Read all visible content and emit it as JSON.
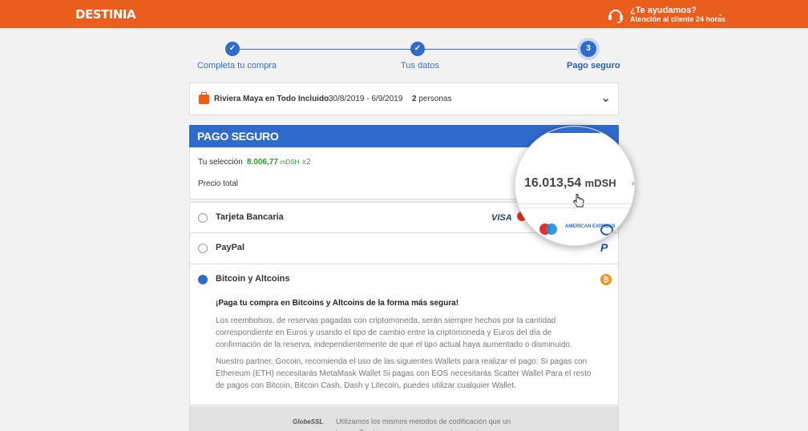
{
  "header": {
    "logo": "DESTINIA",
    "help_title": "¿Te ayudamos?",
    "help_subtitle": "Atención al cliente 24 horas",
    "brand_color": "#e95e1d"
  },
  "steps": [
    {
      "label": "Completa tu compra",
      "state": "done",
      "mark": "✓"
    },
    {
      "label": "Tus datos",
      "state": "done",
      "mark": "✓"
    },
    {
      "label": "Pago seguro",
      "state": "current",
      "mark": "3"
    }
  ],
  "trip": {
    "name": "Riviera Maya en Todo Incluido",
    "dates": "30/8/2019 - 6/9/2019",
    "people_count": "2",
    "people_label": "personas"
  },
  "payment": {
    "header": "PAGO SEGURO",
    "selection_label": "Tu selección",
    "selection_amount": "8.006,77",
    "selection_unit": "mDSH",
    "selection_multiplier": "x2",
    "total_label": "Precio total",
    "total_amount": "16.013,54",
    "total_unit": "mDSH",
    "accent_color": "#2f6bcb"
  },
  "methods": [
    {
      "label": "Tarjeta Bancaria",
      "selected": false
    },
    {
      "label": "PayPal",
      "selected": false
    },
    {
      "label": "Bitcoin y Altcoins",
      "selected": true
    }
  ],
  "card_logos": {
    "visa": "VISA",
    "amex": "AMERICAN EXPRESS"
  },
  "bitcoin_details": {
    "heading": "¡Paga tu compra en Bitcoins y Altcoins de la forma más segura!",
    "paragraph1": "Los reembolsos, de reservas pagadas con criptomoneda, serán siempre hechos por la cantidad correspondiente en Euros y usando el tipo de cambio entre la criptomoneda y Euros del día de confirmación de la reserva, independientemente de que el tipo actual haya aumentado o disminuido.",
    "paragraph2": "Nuestro partner, Gocoin, recomienda el uso de las siguientes Wallets para realizar el pago: Si pagas con Ethereum (ETH) necesitarás MetaMask Wallet Si pagas con EOS necesitarás Scatter Wallet Para el resto de pagos con Bitcoin, Bitcoin Cash, Dash y Litecoin, puedes utilizar cualquier Wallet."
  },
  "security": {
    "badge": "GlobeSSL",
    "text": "Utilizamos los mismos métodos de codificación que un banco. Tus transacciones son completamente seguras."
  }
}
